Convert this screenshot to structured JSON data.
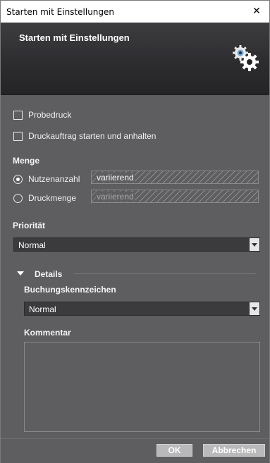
{
  "window": {
    "title": "Starten mit Einstellungen",
    "close_glyph": "✕"
  },
  "header": {
    "title": "Starten mit Einstellungen",
    "icon": "gears-icon"
  },
  "options": {
    "test_print": {
      "label": "Probedruck",
      "checked": false
    },
    "start_and_hold": {
      "label": "Druckauftrag starten und anhalten",
      "checked": false
    }
  },
  "quantity": {
    "heading": "Menge",
    "copies": {
      "label": "Nutzenanzahl",
      "value": "variierend",
      "selected": true
    },
    "print_quantity": {
      "label": "Druckmenge",
      "value": "variierend",
      "selected": false
    }
  },
  "priority": {
    "heading": "Priorität",
    "value": "Normal"
  },
  "details": {
    "heading": "Details",
    "booking_code": {
      "label": "Buchungskennzeichen",
      "value": "Normal"
    },
    "comment": {
      "label": "Kommentar",
      "value": ""
    }
  },
  "footer": {
    "ok_label": "OK",
    "cancel_label": "Abbrechen"
  }
}
